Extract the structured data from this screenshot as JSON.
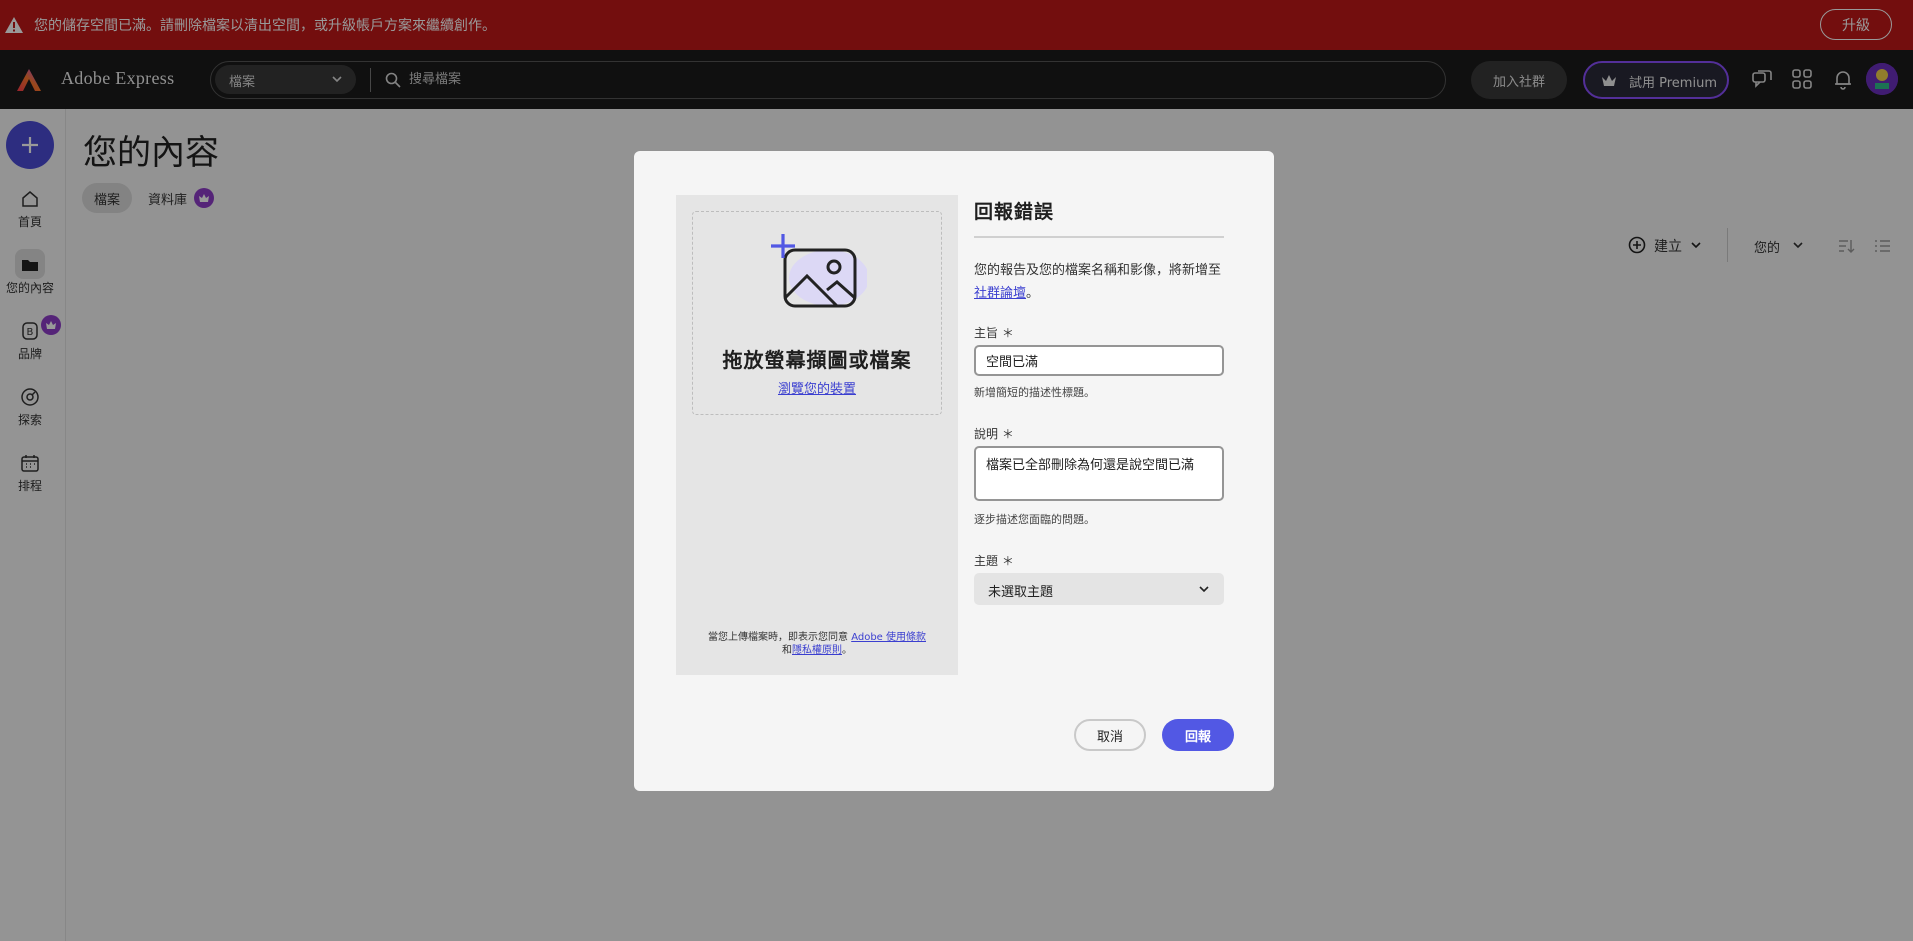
{
  "banner": {
    "message": "您的儲存空間已滿。請刪除檔案以清出空間，或升級帳戶方案來繼續創作。",
    "upgrade_label": "升級",
    "color": "#c01818"
  },
  "topbar": {
    "app_title": "Adobe Express",
    "search_scope": "檔案",
    "search_placeholder": "搜尋檔案",
    "join_label": "加入社群",
    "premium_label": "試用 Premium",
    "icons": [
      "chat-icon",
      "apps-grid-icon",
      "bell-icon",
      "avatar"
    ]
  },
  "sidebar": {
    "items": [
      {
        "label": "首頁",
        "icon": "home-icon"
      },
      {
        "label": "您的內容",
        "icon": "folder-icon",
        "active": true
      },
      {
        "label": "品牌",
        "icon": "brand-icon",
        "premium": true
      },
      {
        "label": "探索",
        "icon": "discover-icon"
      },
      {
        "label": "排程",
        "icon": "calendar-icon"
      }
    ]
  },
  "main": {
    "title": "您的內容",
    "tabs": [
      {
        "label": "檔案",
        "active": true
      },
      {
        "label": "資料庫",
        "premium": true
      }
    ],
    "create_label": "建立",
    "owner_filter": "您的"
  },
  "modal": {
    "drop_title": "拖放螢幕擷圖或檔案",
    "drop_link": "瀏覽您的裝置",
    "terms_prefix": "當您上傳檔案時，即表示您同意 ",
    "terms_link1": "Adobe 使用條款",
    "terms_mid": "和",
    "terms_link2": "隱私權原則",
    "terms_suffix": "。",
    "title": "回報錯誤",
    "desc_prefix": "您的報告及您的檔案名稱和影像，將新增至",
    "desc_link": "社群論壇",
    "desc_suffix": "。",
    "subject_label": "主旨 ＊",
    "subject_value": "空間已滿",
    "subject_help": "新增簡短的描述性標題。",
    "description_label": "說明 ＊",
    "description_value": "檔案已全部刪除為何還是說空間已滿",
    "description_help": "逐步描述您面臨的問題。",
    "topic_label": "主題 ＊",
    "topic_value": "未選取主題",
    "cancel_label": "取消",
    "submit_label": "回報",
    "accent": "#5258e4"
  }
}
